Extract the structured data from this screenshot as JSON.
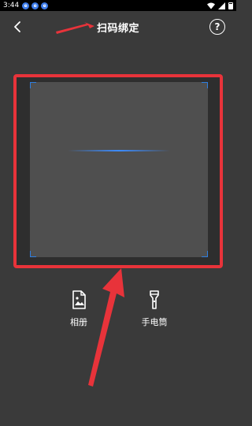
{
  "status_bar": {
    "time": "3:44",
    "app_icons": [
      "e",
      "e",
      "e"
    ]
  },
  "header": {
    "title": "扫码绑定",
    "help_glyph": "?"
  },
  "actions": {
    "album_label": "相册",
    "flashlight_label": "手电筒"
  },
  "colors": {
    "background": "#3a3a3a",
    "highlight_red": "#e8333a",
    "scan_accent": "#2f7fe0"
  }
}
